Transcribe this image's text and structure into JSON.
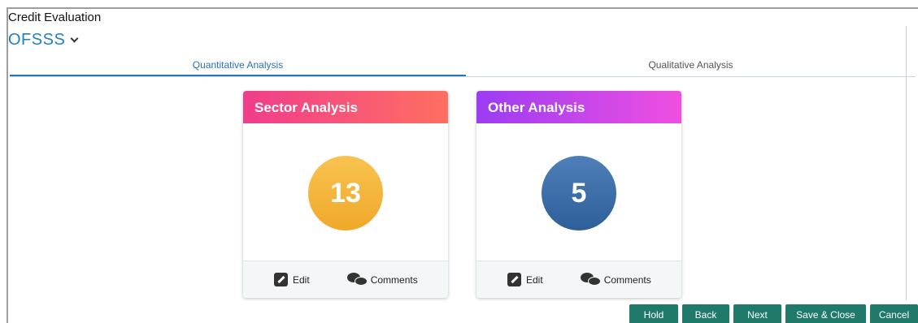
{
  "page": {
    "title": "Credit Evaluation",
    "app_name": "OFSSS"
  },
  "tabs": [
    {
      "label": "Quantitative Analysis",
      "active": true
    },
    {
      "label": "Qualitative Analysis",
      "active": false
    }
  ],
  "cards": [
    {
      "title": "Sector Analysis",
      "count": "13",
      "header_gradient": [
        "#f03d8c",
        "#ff6f61"
      ],
      "circle_gradient": [
        "#f8c350",
        "#f0a82a"
      ],
      "edit_label": "Edit",
      "comments_label": "Comments"
    },
    {
      "title": "Other Analysis",
      "count": "5",
      "header_gradient": [
        "#9b3cf3",
        "#ef4fe0"
      ],
      "circle_gradient": [
        "#4f7fb8",
        "#2f5f98"
      ],
      "edit_label": "Edit",
      "comments_label": "Comments"
    }
  ],
  "footer": {
    "hold": "Hold",
    "back": "Back",
    "next": "Next",
    "save_close": "Save & Close",
    "cancel": "Cancel"
  },
  "colors": {
    "accent": "#2a73b5",
    "button": "#1f7a6a"
  }
}
